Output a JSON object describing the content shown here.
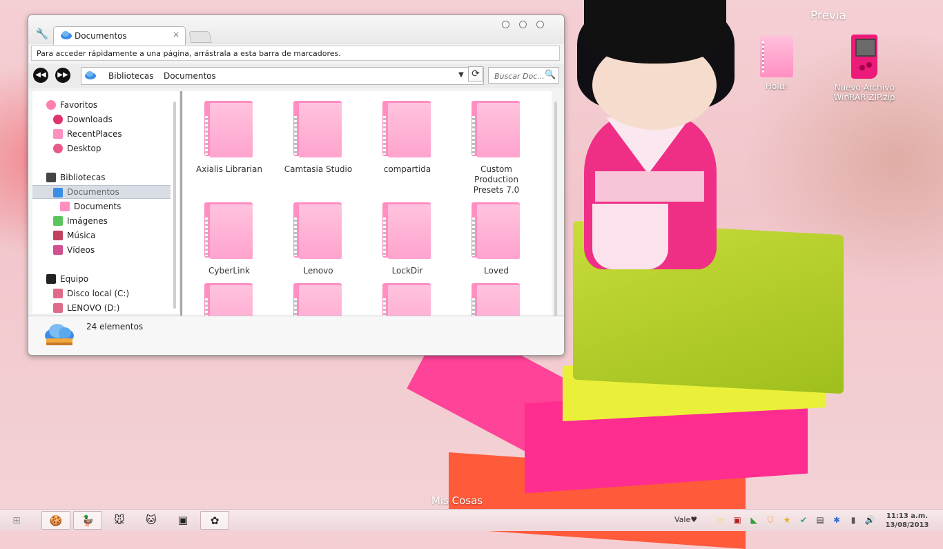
{
  "desktop": {
    "label_top": "Previa",
    "label_bottom": "Mis Cosas",
    "icons": [
      {
        "name": "Holu!",
        "icon": "pink-folder-icon"
      },
      {
        "name": "Nuevo Archivo WinRAR ZIP.zip",
        "icon": "gameboy-icon"
      }
    ]
  },
  "window": {
    "tab_title": "Documentos",
    "tab_close": "×",
    "bookmarks_hint": "Para acceder rápidamente a una página, arrástrala a esta barra de marcadores.",
    "nav_back": "◀◀",
    "nav_forward": "▶▶",
    "breadcrumb": [
      "Bibliotecas",
      "Documentos"
    ],
    "address_dropdown": "▼",
    "refresh": "⟳",
    "search_placeholder": "Buscar Doc...",
    "search_icon": "🔍",
    "sidebar": [
      {
        "label": "Favoritos",
        "icon": "heart-icon",
        "color": "#ff7fb0",
        "indent": 0,
        "section": true
      },
      {
        "label": "Downloads",
        "icon": "downloads-icon",
        "color": "#e0306e",
        "indent": 1
      },
      {
        "label": "RecentPlaces",
        "icon": "recent-places-icon",
        "color": "#ff8fc1",
        "indent": 1
      },
      {
        "label": "Desktop",
        "icon": "desktop-icon",
        "color": "#e85a8a",
        "indent": 1
      },
      {
        "label": "Bibliotecas",
        "icon": "libraries-icon",
        "color": "#444444",
        "indent": 0,
        "section": true
      },
      {
        "label": "Documentos",
        "icon": "cloud-icon",
        "color": "#3a8ee6",
        "indent": 1,
        "selected": true
      },
      {
        "label": "Documents",
        "icon": "pink-folder-icon",
        "color": "#ff8fc1",
        "indent": 2
      },
      {
        "label": "Imágenes",
        "icon": "images-icon",
        "color": "#5cc45c",
        "indent": 1
      },
      {
        "label": "Música",
        "icon": "music-icon",
        "color": "#c04060",
        "indent": 1
      },
      {
        "label": "Vídeos",
        "icon": "videos-icon",
        "color": "#d05090",
        "indent": 1
      },
      {
        "label": "Equipo",
        "icon": "computer-icon",
        "color": "#222222",
        "indent": 0,
        "section": true
      },
      {
        "label": "Disco local (C:)",
        "icon": "drive-icon",
        "color": "#e06a8a",
        "indent": 1
      },
      {
        "label": "LENOVO (D:)",
        "icon": "drive-icon",
        "color": "#e06a8a",
        "indent": 1
      }
    ],
    "folders": [
      [
        "Axialis Librarian",
        ""
      ],
      [
        "Camtasia Studio",
        ""
      ],
      [
        "compartida",
        ""
      ],
      [
        "Custom",
        "Production",
        "Presets 7.0"
      ],
      [
        "CyberLink",
        ""
      ],
      [
        "Lenovo",
        ""
      ],
      [
        "LockDir",
        ""
      ],
      [
        "Loved",
        ""
      ],
      [
        "",
        ""
      ],
      [
        "",
        ""
      ],
      [
        "",
        ""
      ],
      [
        "",
        ""
      ]
    ],
    "status_count": "24 elementos"
  },
  "taskbar": {
    "start_icon": "⊞",
    "buttons": [
      {
        "icon": "cookie-icon",
        "glyph": "🍪",
        "active": true
      },
      {
        "icon": "duck-icon",
        "glyph": "🦆",
        "active": true
      },
      {
        "icon": "mickey-icon",
        "glyph": "🐭",
        "active": false
      },
      {
        "icon": "cat-icon",
        "glyph": "🐱",
        "active": false
      },
      {
        "icon": "terminal-icon",
        "glyph": "▣",
        "active": false
      },
      {
        "icon": "puzzle-icon",
        "glyph": "✿",
        "active": true
      }
    ],
    "vale_label": "Vale",
    "vale_glyph": "♥",
    "tray": [
      "note-icon",
      "network-icon",
      "antivirus-icon",
      "shield-icon",
      "star-icon",
      "check-icon",
      "clipboard-icon",
      "bluetooth-icon",
      "signal-icon",
      "volume-icon"
    ],
    "tray_glyphs": [
      "▭",
      "▣",
      "◣",
      "⛉",
      "★",
      "✔",
      "▤",
      "✱",
      "▮",
      "🔊"
    ],
    "clock_time": "11:13 a.m.",
    "clock_date": "13/08/2013"
  },
  "colors": {
    "folder_pink": "#ff8ec2",
    "selection": "#d8dde5",
    "cloud_blue": "#3a8ee6"
  }
}
